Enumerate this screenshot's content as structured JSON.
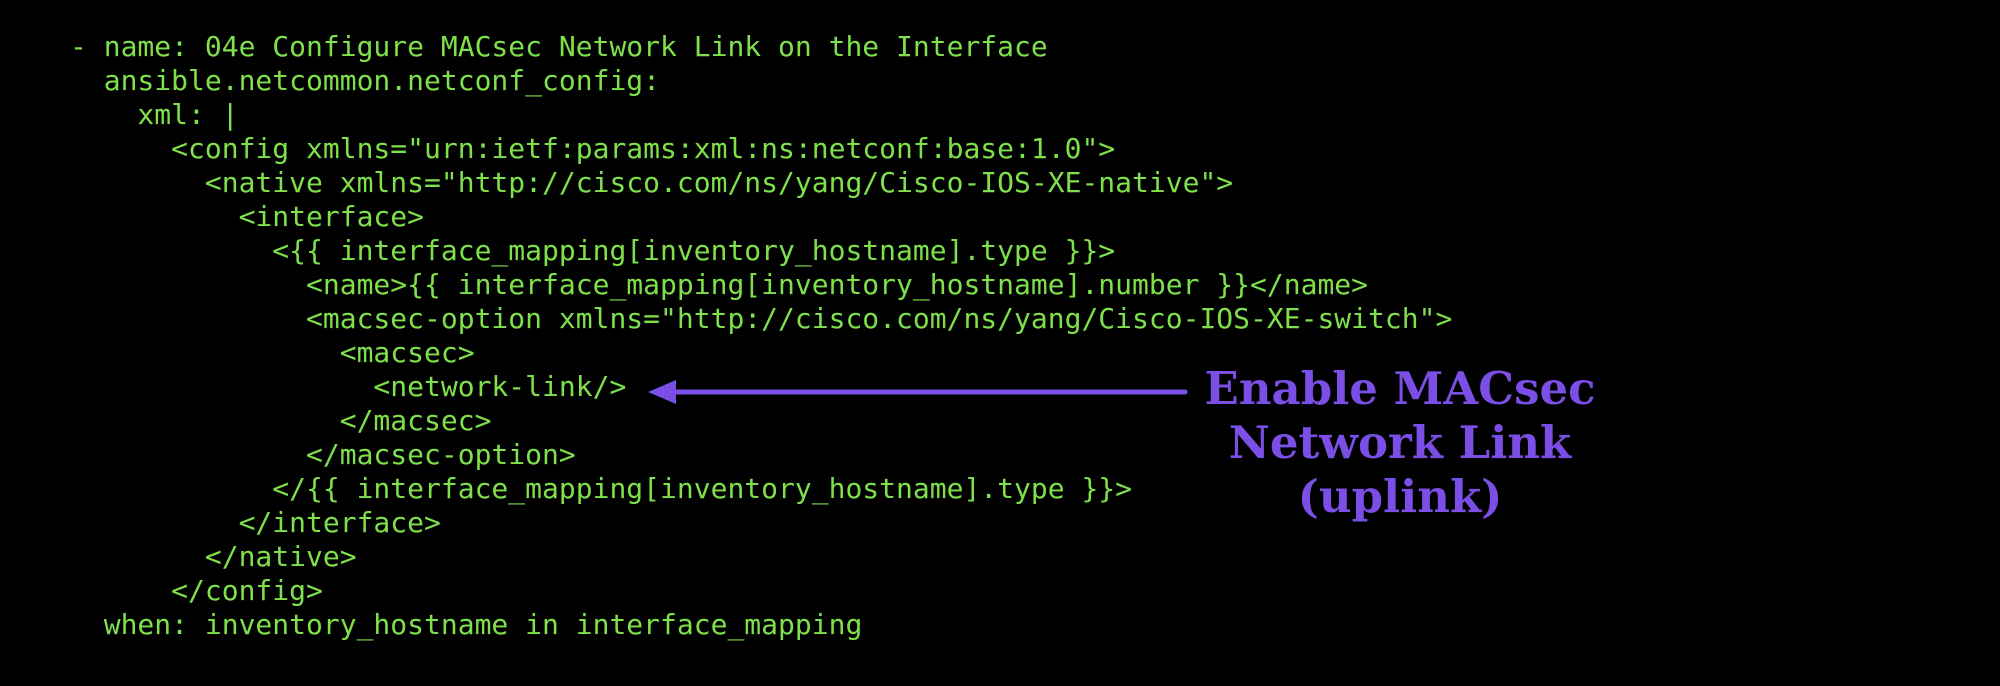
{
  "code": {
    "lines": [
      "- name: 04e Configure MACsec Network Link on the Interface",
      "  ansible.netcommon.netconf_config:",
      "    xml: |",
      "      <config xmlns=\"urn:ietf:params:xml:ns:netconf:base:1.0\">",
      "        <native xmlns=\"http://cisco.com/ns/yang/Cisco-IOS-XE-native\">",
      "          <interface>",
      "            <{{ interface_mapping[inventory_hostname].type }}>",
      "              <name>{{ interface_mapping[inventory_hostname].number }}</name>",
      "              <macsec-option xmlns=\"http://cisco.com/ns/yang/Cisco-IOS-XE-switch\">",
      "                <macsec>",
      "                  <network-link/>",
      "                </macsec>",
      "              </macsec-option>",
      "            </{{ interface_mapping[inventory_hostname].type }}>",
      "          </interface>",
      "        </native>",
      "      </config>",
      "  when: inventory_hostname in interface_mapping"
    ],
    "color": "#7ee04a"
  },
  "annotation": {
    "lines": [
      "Enable MACsec",
      "Network Link",
      "(uplink)"
    ],
    "color": "#7b4fe6",
    "arrow_icon": "arrow-left-icon"
  },
  "background": "#000000"
}
